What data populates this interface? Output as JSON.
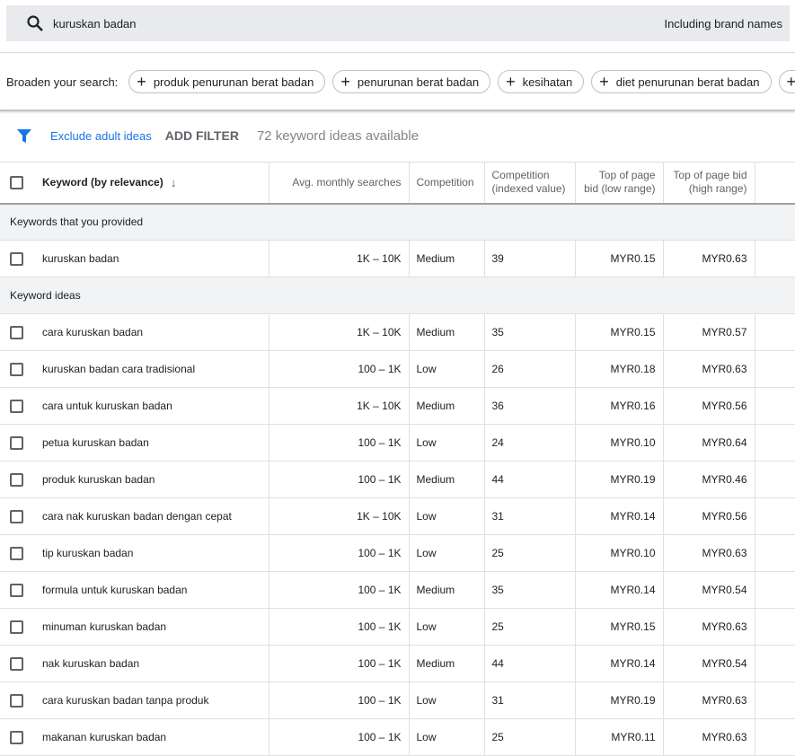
{
  "search": {
    "query": "kuruskan badan",
    "brand_label": "Including brand names",
    "icon": "search-icon"
  },
  "broaden": {
    "label": "Broaden your search:",
    "chips": [
      "produk penurunan berat badan",
      "penurunan berat badan",
      "kesihatan",
      "diet penurunan berat badan"
    ]
  },
  "filter": {
    "icon": "filter-icon",
    "exclude": "Exclude adult ideas",
    "add": "ADD FILTER",
    "count": "72 keyword ideas available",
    "accent": "#1a73e8"
  },
  "table": {
    "headers": [
      "Keyword (by relevance)",
      "Avg. monthly searches",
      "Competition",
      "Competition (indexed value)",
      "Top of page bid (low range)",
      "Top of page bid (high range)"
    ],
    "group1": "Keywords that you provided",
    "provided": [
      [
        "kuruskan badan",
        "1K – 10K",
        "Medium",
        "39",
        "MYR0.15",
        "MYR0.63"
      ]
    ],
    "group2": "Keyword ideas",
    "ideas": [
      [
        "cara kuruskan badan",
        "1K – 10K",
        "Medium",
        "35",
        "MYR0.15",
        "MYR0.57"
      ],
      [
        "kuruskan badan cara tradisional",
        "100 – 1K",
        "Low",
        "26",
        "MYR0.18",
        "MYR0.63"
      ],
      [
        "cara untuk kuruskan badan",
        "1K – 10K",
        "Medium",
        "36",
        "MYR0.16",
        "MYR0.56"
      ],
      [
        "petua kuruskan badan",
        "100 – 1K",
        "Low",
        "24",
        "MYR0.10",
        "MYR0.64"
      ],
      [
        "produk kuruskan badan",
        "100 – 1K",
        "Medium",
        "44",
        "MYR0.19",
        "MYR0.46"
      ],
      [
        "cara nak kuruskan badan dengan cepat",
        "1K – 10K",
        "Low",
        "31",
        "MYR0.14",
        "MYR0.56"
      ],
      [
        "tip kuruskan badan",
        "100 – 1K",
        "Low",
        "25",
        "MYR0.10",
        "MYR0.63"
      ],
      [
        "formula untuk kuruskan badan",
        "100 – 1K",
        "Medium",
        "35",
        "MYR0.14",
        "MYR0.54"
      ],
      [
        "minuman kuruskan badan",
        "100 – 1K",
        "Low",
        "25",
        "MYR0.15",
        "MYR0.63"
      ],
      [
        "nak kuruskan badan",
        "100 – 1K",
        "Medium",
        "44",
        "MYR0.14",
        "MYR0.54"
      ],
      [
        "cara kuruskan badan tanpa produk",
        "100 – 1K",
        "Low",
        "31",
        "MYR0.19",
        "MYR0.63"
      ],
      [
        "makanan kuruskan badan",
        "100 – 1K",
        "Low",
        "25",
        "MYR0.11",
        "MYR0.63"
      ]
    ]
  }
}
